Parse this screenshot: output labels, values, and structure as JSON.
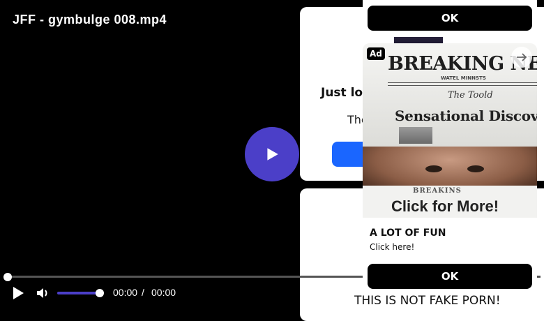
{
  "video": {
    "title": "JFF - gymbulge 008.mp4",
    "current_time": "00:00",
    "separator": "/",
    "duration": "00:00",
    "progress": 0,
    "volume": 1.0
  },
  "card1": {
    "heading": "Just loo",
    "subtext": "The"
  },
  "page": {
    "bottom_text": "THIS IS NOT FAKE PORN!"
  },
  "popup_top": {
    "ok_label": "OK"
  },
  "ad_popup": {
    "badge": "Ad",
    "image": {
      "headline": "BREAKING NEWS",
      "small_text": "WATEL MINNSTS",
      "tagline": "The Toold",
      "discovery": "Sensational Discovery!",
      "lower_paper": "BREAKINS",
      "cta": "Click for More!"
    },
    "title": "A LOT OF FUN",
    "subtitle": "Click here!",
    "ok_label": "OK"
  },
  "colors": {
    "accent": "#4b3fc8",
    "card_button": "#1a66ff",
    "background": "#000000"
  }
}
